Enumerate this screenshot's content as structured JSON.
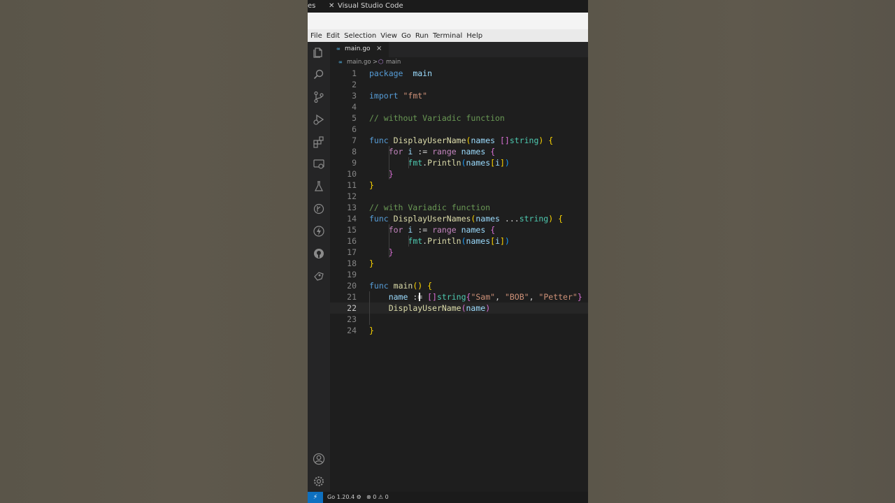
{
  "window": {
    "title": "Visual Studio Code",
    "left_fragment": "es"
  },
  "menu": [
    "File",
    "Edit",
    "Selection",
    "View",
    "Go",
    "Run",
    "Terminal",
    "Help"
  ],
  "tab": {
    "icon_text": "∞",
    "filename": "main.go",
    "close": "×"
  },
  "breadcrumb": {
    "file_icon_text": "∞",
    "file": "main.go",
    "separator": ">",
    "symbol_icon": "⬡",
    "symbol": "main"
  },
  "activity_icons": [
    "explorer-icon",
    "search-icon",
    "source-control-icon",
    "run-debug-icon",
    "extensions-icon",
    "remote-explorer-icon",
    "testing-icon",
    "timeline-icon",
    "thunder-icon",
    "github-icon",
    "docker-icon"
  ],
  "activity_bottom_icons": [
    "account-icon",
    "settings-gear-icon"
  ],
  "editor": {
    "current_line": 22,
    "lines": [
      {
        "n": "1",
        "t": [
          [
            "kw",
            "package"
          ],
          [
            "",
            "  "
          ],
          [
            "var",
            "main"
          ]
        ]
      },
      {
        "n": "2",
        "t": []
      },
      {
        "n": "3",
        "t": [
          [
            "kw",
            "import"
          ],
          [
            "",
            " "
          ],
          [
            "str",
            "\"fmt\""
          ]
        ]
      },
      {
        "n": "4",
        "t": []
      },
      {
        "n": "5",
        "t": [
          [
            "cmt",
            "// without Variadic function"
          ]
        ]
      },
      {
        "n": "6",
        "t": []
      },
      {
        "n": "7",
        "t": [
          [
            "kw",
            "func"
          ],
          [
            "",
            " "
          ],
          [
            "fn",
            "DisplayUserName"
          ],
          [
            "br1",
            "("
          ],
          [
            "var",
            "names"
          ],
          [
            "",
            " "
          ],
          [
            "br2",
            "[]"
          ],
          [
            "typ",
            "string"
          ],
          [
            "br1",
            ")"
          ],
          [
            "",
            " "
          ],
          [
            "br1",
            "{"
          ]
        ]
      },
      {
        "n": "8",
        "t": [
          [
            "",
            "    "
          ],
          [
            "kw2",
            "for"
          ],
          [
            "",
            " "
          ],
          [
            "var",
            "i"
          ],
          [
            "",
            " := "
          ],
          [
            "kw2",
            "range"
          ],
          [
            "",
            " "
          ],
          [
            "var",
            "names"
          ],
          [
            "",
            " "
          ],
          [
            "br2",
            "{"
          ]
        ]
      },
      {
        "n": "9",
        "t": [
          [
            "",
            "        "
          ],
          [
            "typ",
            "fmt"
          ],
          [
            "",
            "."
          ],
          [
            "fn",
            "Println"
          ],
          [
            "br3",
            "("
          ],
          [
            "var",
            "names"
          ],
          [
            "br1",
            "["
          ],
          [
            "var",
            "i"
          ],
          [
            "br1",
            "]"
          ],
          [
            "br3",
            ")"
          ]
        ]
      },
      {
        "n": "10",
        "t": [
          [
            "",
            "    "
          ],
          [
            "br2",
            "}"
          ]
        ]
      },
      {
        "n": "11",
        "t": [
          [
            "br1",
            "}"
          ]
        ]
      },
      {
        "n": "12",
        "t": []
      },
      {
        "n": "13",
        "t": [
          [
            "cmt",
            "// with Variadic function"
          ]
        ]
      },
      {
        "n": "14",
        "t": [
          [
            "kw",
            "func"
          ],
          [
            "",
            " "
          ],
          [
            "fn",
            "DisplayUserNames"
          ],
          [
            "br1",
            "("
          ],
          [
            "var",
            "names"
          ],
          [
            "",
            " ..."
          ],
          [
            "typ",
            "string"
          ],
          [
            "br1",
            ")"
          ],
          [
            "",
            " "
          ],
          [
            "br1",
            "{"
          ]
        ]
      },
      {
        "n": "15",
        "t": [
          [
            "",
            "    "
          ],
          [
            "kw2",
            "for"
          ],
          [
            "",
            " "
          ],
          [
            "var",
            "i"
          ],
          [
            "",
            " := "
          ],
          [
            "kw2",
            "range"
          ],
          [
            "",
            " "
          ],
          [
            "var",
            "names"
          ],
          [
            "",
            " "
          ],
          [
            "br2",
            "{"
          ]
        ]
      },
      {
        "n": "16",
        "t": [
          [
            "",
            "        "
          ],
          [
            "typ",
            "fmt"
          ],
          [
            "",
            "."
          ],
          [
            "fn",
            "Println"
          ],
          [
            "br3",
            "("
          ],
          [
            "var",
            "names"
          ],
          [
            "br1",
            "["
          ],
          [
            "var",
            "i"
          ],
          [
            "br1",
            "]"
          ],
          [
            "br3",
            ")"
          ]
        ]
      },
      {
        "n": "17",
        "t": [
          [
            "",
            "    "
          ],
          [
            "br2",
            "}"
          ]
        ]
      },
      {
        "n": "18",
        "t": [
          [
            "br1",
            "}"
          ]
        ]
      },
      {
        "n": "19",
        "t": []
      },
      {
        "n": "20",
        "t": [
          [
            "kw",
            "func"
          ],
          [
            "",
            " "
          ],
          [
            "fn",
            "main"
          ],
          [
            "br1",
            "()"
          ],
          [
            "",
            " "
          ],
          [
            "br1",
            "{"
          ]
        ]
      },
      {
        "n": "21",
        "t": [
          [
            "",
            "    "
          ],
          [
            "var",
            "name"
          ],
          [
            "",
            " := "
          ],
          [
            "br2",
            "[]"
          ],
          [
            "typ",
            "string"
          ],
          [
            "br2",
            "{"
          ],
          [
            "str",
            "\"Sam\""
          ],
          [
            "",
            ", "
          ],
          [
            "str",
            "\"BOB\""
          ],
          [
            "",
            ", "
          ],
          [
            "str",
            "\"Petter\""
          ],
          [
            "br2",
            "}"
          ]
        ]
      },
      {
        "n": "22",
        "t": [
          [
            "",
            "    "
          ],
          [
            "fn",
            "DisplayUserName"
          ],
          [
            "br2",
            "("
          ],
          [
            "var",
            "name"
          ],
          [
            "br2",
            ")"
          ]
        ]
      },
      {
        "n": "23",
        "t": []
      },
      {
        "n": "24",
        "t": [
          [
            "br1",
            "}"
          ]
        ]
      }
    ]
  },
  "status": {
    "remote": "⚡",
    "go_version": "Go 1.20.4 ⚙",
    "problems": "⊗ 0 ⚠ 0"
  }
}
